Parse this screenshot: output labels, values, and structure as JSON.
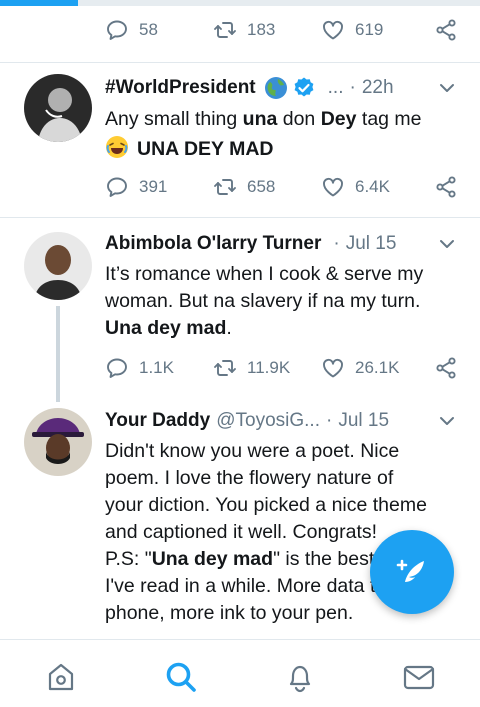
{
  "colors": {
    "accent": "#1da1f2",
    "muted": "#657786",
    "text": "#14171a",
    "divider": "#e1e8ed"
  },
  "top_actions": {
    "replies": "58",
    "retweets": "183",
    "likes": "619"
  },
  "tweets": [
    {
      "name": "#WorldPresident",
      "handle": "...",
      "time": "22h",
      "lines": [
        [
          {
            "t": "Any small thing "
          },
          {
            "t": "una",
            "b": true
          },
          {
            "t": " don "
          },
          {
            "t": "Dey",
            "b": true
          },
          {
            "t": " tag me"
          }
        ],
        [
          {
            "t": "UNA DEY MAD",
            "b": true
          }
        ]
      ],
      "replies": "391",
      "retweets": "658",
      "likes": "6.4K",
      "icons": [
        "globe-icon",
        "verified-icon",
        "laughing-emoji-icon"
      ]
    },
    {
      "name": "Abimbola O'larry Turner",
      "handle": "",
      "time": "Jul 15",
      "lines": [
        [
          {
            "t": "It’s romance when I cook & serve my"
          }
        ],
        [
          {
            "t": "woman. But na slavery if na my turn."
          }
        ],
        [
          {
            "t": "Una dey mad",
            "b": true
          },
          {
            "t": "."
          }
        ]
      ],
      "replies": "1.1K",
      "retweets": "11.9K",
      "likes": "26.1K"
    },
    {
      "name": "Your Daddy",
      "handle": "@ToyosiG...",
      "time": "Jul 15",
      "lines": [
        [
          {
            "t": "Didn't know you were a poet. Nice"
          }
        ],
        [
          {
            "t": "poem. I love the flowery nature of"
          }
        ],
        [
          {
            "t": "your diction. You picked a nice theme"
          }
        ],
        [
          {
            "t": "and captioned it well. Congrats!"
          }
        ],
        [
          {
            "t": " "
          }
        ],
        [
          {
            "t": "P.S: \""
          },
          {
            "t": "Una dey mad",
            "b": true
          },
          {
            "t": "\" is the best"
          }
        ],
        [
          {
            "t": "I've read in a while. More data to your"
          }
        ],
        [
          {
            "t": "phone, more ink to your pen."
          }
        ]
      ]
    }
  ],
  "nav": [
    "home-icon",
    "search-icon",
    "notifications-icon",
    "messages-icon"
  ]
}
